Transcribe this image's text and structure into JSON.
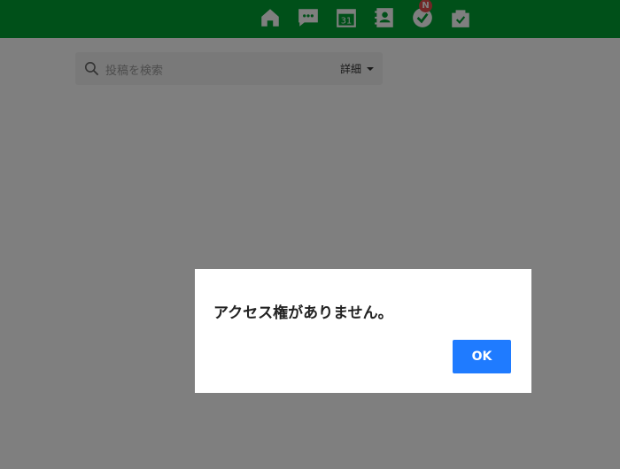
{
  "header": {
    "bg_color": "#00a032",
    "nav": [
      {
        "icon": "home-icon"
      },
      {
        "icon": "chat-icon"
      },
      {
        "icon": "calendar-icon",
        "label": "31"
      },
      {
        "icon": "contacts-icon"
      },
      {
        "icon": "task-check-icon",
        "badge": "N"
      },
      {
        "icon": "approval-bag-icon"
      }
    ]
  },
  "search": {
    "placeholder": "投稿を検索",
    "detail_label": "詳細"
  },
  "dialog": {
    "message": "アクセス権がありません。",
    "ok_label": "OK",
    "ok_color": "#1f7bff"
  }
}
